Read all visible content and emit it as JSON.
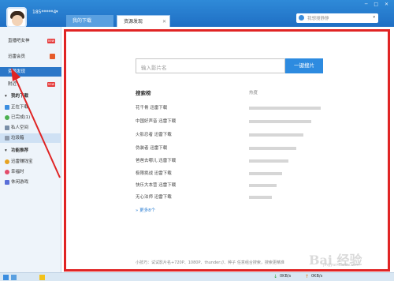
{
  "header": {
    "username": "185*****4",
    "username_caret": "▾",
    "user_subtitle": "",
    "window_controls": "─ □ ✕",
    "tabs": [
      {
        "label": "我的下载",
        "active": false
      },
      {
        "label": "资源发现",
        "active": true,
        "close": "✕"
      }
    ],
    "search": {
      "placeholder": "我想搜静静",
      "dropdown": "▾"
    }
  },
  "sidebar": {
    "items": [
      {
        "label": "直播吧女神",
        "badge": "new",
        "kind": "plain"
      },
      {
        "label": "迅雷会员",
        "kind": "plain"
      },
      {
        "label": "资源发现",
        "kind": "selected"
      },
      {
        "label": "附近",
        "badge": "new",
        "kind": "plain"
      },
      {
        "label": "我的下载",
        "kind": "header"
      },
      {
        "label": "正在下载",
        "kind": "child",
        "icon": "download-icon"
      },
      {
        "label": "已完成(1)",
        "kind": "child",
        "icon": "check-icon"
      },
      {
        "label": "私人空间",
        "kind": "child",
        "icon": "lock-icon"
      },
      {
        "label": "垃圾箱",
        "kind": "child-selected",
        "icon": "trash-icon"
      },
      {
        "label": "功能推荐",
        "kind": "header"
      },
      {
        "label": "迅雷赚钱宝",
        "kind": "child",
        "icon": "coin-icon"
      },
      {
        "label": "幸福时",
        "kind": "child",
        "icon": "heart-icon"
      },
      {
        "label": "休闲游戏",
        "kind": "child",
        "icon": "game-icon"
      }
    ]
  },
  "main": {
    "search_placeholder": "输入影片名",
    "search_button": "一键搜片",
    "rank_title": "搜索榜",
    "heat_title": "热度",
    "rankings": [
      {
        "name": "花千骨 迅雷下载",
        "heat": 0.95
      },
      {
        "name": "中国好声音 迅雷下载",
        "heat": 0.82
      },
      {
        "name": "火影忍者 迅雷下载",
        "heat": 0.72
      },
      {
        "name": "伪装者 迅雷下载",
        "heat": 0.62
      },
      {
        "name": "爸爸去哪儿 迅雷下载",
        "heat": 0.52
      },
      {
        "name": "极限挑战 迅雷下载",
        "heat": 0.44
      },
      {
        "name": "快乐大本营 迅雷下载",
        "heat": 0.36
      },
      {
        "name": "无心法师 迅雷下载",
        "heat": 0.3
      }
    ],
    "more_link": "» 更多8个",
    "tip": "小技巧：试试影片名+720P、1080P、thunder://、种子 任意组合搜索，搜索更精准"
  },
  "statusbar": {
    "down_speed": "0KB/s",
    "up_speed": "0KB/s"
  },
  "watermark": {
    "text": "Bai 经验",
    "sub": "jingyan.baidu.com"
  },
  "colors": {
    "accent": "#2d8be0",
    "highlight_frame": "#e02424",
    "annotation_arrow": "#e02424"
  }
}
